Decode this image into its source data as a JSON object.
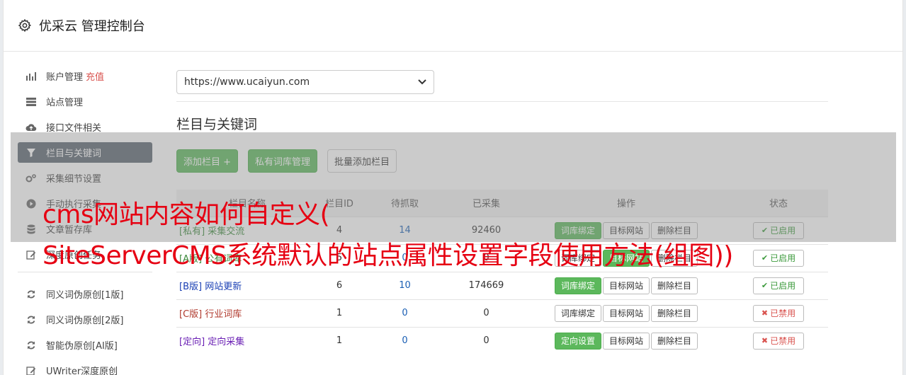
{
  "header": {
    "title": "优采云 管理控制台"
  },
  "sidebar": {
    "items": [
      {
        "label": "账户管理",
        "badge": "充值",
        "icon": "bar-chart-icon"
      },
      {
        "label": "站点管理",
        "icon": "server-icon"
      },
      {
        "label": "接口文件相关",
        "icon": "cloud-upload-icon"
      },
      {
        "label": "栏目与关键词",
        "icon": "filter-icon",
        "active": true
      },
      {
        "label": "采集细节设置",
        "icon": "cogs-icon"
      },
      {
        "label": "手动执行采集",
        "icon": "play-circle-icon"
      },
      {
        "label": "文章暂存库",
        "icon": "database-icon"
      },
      {
        "label": "深度原创任务",
        "icon": "edit-icon"
      }
    ],
    "items2": [
      {
        "label": "同义词伪原创[1版]",
        "icon": "refresh-icon"
      },
      {
        "label": "同义词伪原创[2版]",
        "icon": "refresh-icon"
      },
      {
        "label": "智能伪原创[AI版]",
        "icon": "refresh-icon"
      },
      {
        "label": "UWriter深度原创",
        "icon": "edit-icon"
      }
    ]
  },
  "main": {
    "site_select": "https://www.ucaiyun.com",
    "section_title": "栏目与关键词",
    "buttons": {
      "add": "添加栏目 +",
      "private": "私有词库管理",
      "batch": "批量添加栏目"
    },
    "table": {
      "headers": [
        "栏目名称",
        "栏目ID",
        "待抓取",
        "已采集",
        "操作",
        "状态"
      ],
      "rows": [
        {
          "tag": "[私有]",
          "name": "采集交流",
          "id": "4",
          "pending": "14",
          "collected": "92460",
          "op1": "词库绑定",
          "op1_green": true,
          "op2": "目标网站",
          "op2_green": false,
          "op3": "删除栏目",
          "status": "已启用",
          "enabled": true
        },
        {
          "tag": "[A版]",
          "name": "公有词库",
          "id": "5",
          "pending": "0",
          "collected": "0",
          "op1": "词库绑定",
          "op1_green": false,
          "op2": "目标网站",
          "op2_green": true,
          "op3": "删除栏目",
          "status": "已启用",
          "enabled": true
        },
        {
          "tag": "[B版]",
          "name": "网站更新",
          "id": "6",
          "pending": "10",
          "collected": "174669",
          "op1": "词库绑定",
          "op1_green": true,
          "op2": "目标网站",
          "op2_green": false,
          "op3": "删除栏目",
          "status": "已启用",
          "enabled": true
        },
        {
          "tag": "[C版]",
          "name": "行业词库",
          "id": "1",
          "pending": "0",
          "collected": "0",
          "op1": "词库绑定",
          "op1_green": false,
          "op2": "目标网站",
          "op2_green": false,
          "op3": "删除栏目",
          "status": "已禁用",
          "enabled": false
        },
        {
          "tag": "[定向]",
          "name": "定向采集",
          "id": "1",
          "pending": "0",
          "collected": "0",
          "op1": "定向设置",
          "op1_green": true,
          "op2": "目标网站",
          "op2_green": false,
          "op3": "删除栏目",
          "status": "已禁用",
          "enabled": false
        }
      ]
    }
  },
  "overlay": {
    "line1": "cms网站内容如何自定义(",
    "line2": "SiteServerCMS系统默认的站点属性设置字段使用方法(组图))"
  },
  "colors": {
    "green": "#5cb85c",
    "active_nav": "#5a6470",
    "overlay_text": "#e60012",
    "private_tag": "#3c8a3c",
    "b_tag": "#1a3fb4",
    "c_tag": "#b03a2e",
    "dir_tag": "#6a1fb4"
  }
}
